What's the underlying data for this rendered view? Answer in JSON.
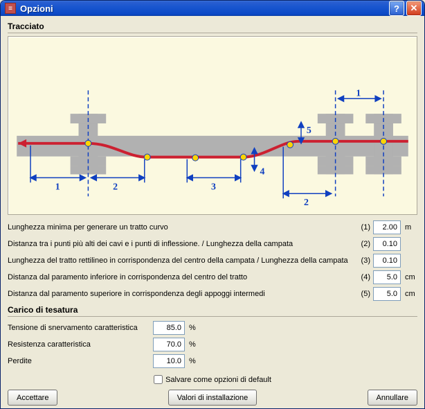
{
  "window": {
    "title": "Opzioni"
  },
  "section_tracciato": {
    "header": "Tracciato"
  },
  "diagram": {
    "dims": [
      "1",
      "2",
      "3",
      "4",
      "5",
      "2",
      "1"
    ]
  },
  "params_tracciato": [
    {
      "label": "Lunghezza minima per generare un tratto curvo",
      "idx": "(1)",
      "value": "2.00",
      "unit": "m"
    },
    {
      "label": "Distanza tra i punti più alti dei cavi e i punti di inflessione. / Lunghezza della campata",
      "idx": "(2)",
      "value": "0.10",
      "unit": ""
    },
    {
      "label": "Lunghezza del tratto rettilineo in corrispondenza del centro della campata / Lunghezza della campata",
      "idx": "(3)",
      "value": "0.10",
      "unit": ""
    },
    {
      "label": "Distanza dal paramento inferiore in corrispondenza del centro del tratto",
      "idx": "(4)",
      "value": "5.0",
      "unit": "cm"
    },
    {
      "label": "Distanza dal paramento superiore in corrispondenza degli appoggi intermedi",
      "idx": "(5)",
      "value": "5.0",
      "unit": "cm"
    }
  ],
  "section_tesatura": {
    "header": "Carico di tesatura"
  },
  "params_tesatura": [
    {
      "label": "Tensione di snervamento caratteristica",
      "value": "85.0",
      "unit": "%"
    },
    {
      "label": "Resistenza caratteristica",
      "value": "70.0",
      "unit": "%"
    },
    {
      "label": "Perdite",
      "value": "10.0",
      "unit": "%"
    }
  ],
  "checkbox": {
    "label": "Salvare come opzioni di default"
  },
  "buttons": {
    "accept": "Accettare",
    "install": "Valori di installazione",
    "cancel": "Annullare"
  }
}
